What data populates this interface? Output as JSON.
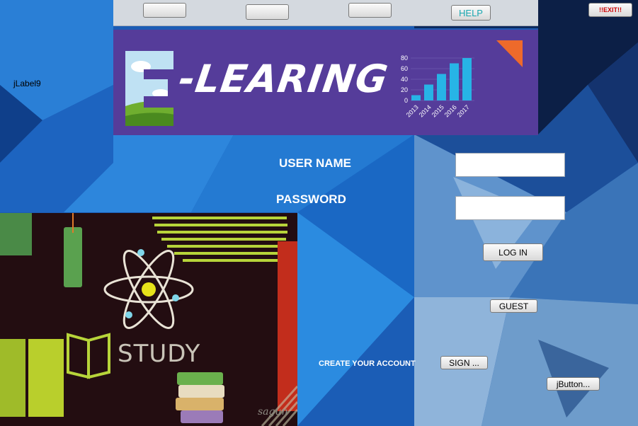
{
  "top_bar": {
    "buttons": [
      "",
      "",
      ""
    ],
    "help_label": "HELP"
  },
  "exit_label": "!!EXIT!!",
  "side_label": "jLabel9",
  "banner": {
    "logo_letter": "E",
    "title": "-LEARING",
    "chart_data": {
      "type": "bar",
      "categories": [
        "2013",
        "2014",
        "2015",
        "2016",
        "2017"
      ],
      "values": [
        10,
        30,
        50,
        70,
        80
      ],
      "yticks": [
        0,
        20,
        40,
        60,
        80
      ],
      "ylim": [
        0,
        80
      ],
      "title": "",
      "xlabel": "",
      "ylabel": ""
    }
  },
  "form": {
    "username_label": "USER NAME",
    "password_label": "PASSWORD",
    "username_value": "",
    "password_value": "",
    "login_label": "LOG IN",
    "guest_label": "GUEST",
    "create_account_label": "CREATE YOUR ACCOUNT",
    "sign_label": "SIGN ...",
    "extra_button_label": "jButton..."
  },
  "study_image": {
    "caption": "STUDY",
    "watermark": "sagun"
  },
  "colors": {
    "banner_bg": "#553c9a",
    "bar_color": "#27b4e6",
    "accent_orange": "#ee6a2b",
    "help_text": "#1aa7b0",
    "exit_text": "#cc0000"
  }
}
